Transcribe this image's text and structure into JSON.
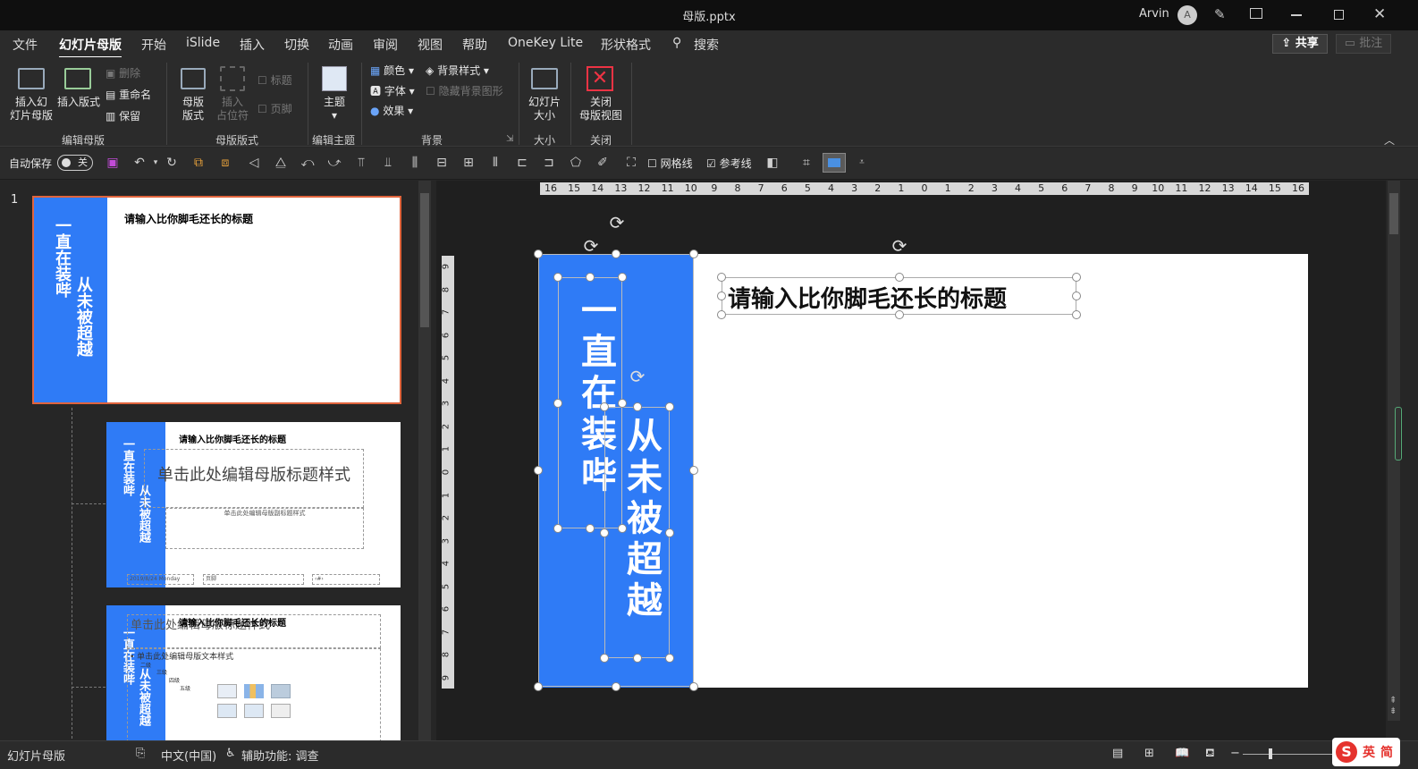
{
  "window": {
    "title": "母版.pptx",
    "user": "Arvin",
    "avatar_letter": "A"
  },
  "menu": {
    "tabs": [
      "文件",
      "幻灯片母版",
      "开始",
      "iSlide",
      "插入",
      "切换",
      "动画",
      "审阅",
      "视图",
      "帮助",
      "OneKey Lite",
      "形状格式"
    ],
    "search_label": "搜索",
    "share_label": "共享",
    "comment_label": "批注"
  },
  "ribbon": {
    "insert_master": "插入幻\n灯片母版",
    "insert_layout": "插入版式",
    "delete": "删除",
    "rename": "重命名",
    "preserve": "保留",
    "group_edit_master": "编辑母版",
    "master_layout": "母版\n版式",
    "insert_placeholder": "插入\n占位符",
    "title_cb": "标题",
    "footer_cb": "页脚",
    "group_master_layout": "母版版式",
    "theme": "主题",
    "group_edit_theme": "编辑主题",
    "colors": "颜色",
    "fonts": "字体",
    "effects": "效果",
    "bg_styles": "背景样式",
    "hide_bg": "隐藏背景图形",
    "group_background": "背景",
    "slide_size": "幻灯片\n大小",
    "group_size": "大小",
    "close_master": "关闭\n母版视图",
    "group_close": "关闭"
  },
  "qat": {
    "autosave": "自动保存",
    "autosave_state": "关",
    "gridlines": "网格线",
    "guides": "参考线"
  },
  "slides": {
    "index": "1",
    "title": "请输入比你脚毛还长的标题",
    "vtext1": "一直在装哔",
    "vtext2": "从未被超越",
    "layout1_title": "单击此处编辑母版标题样式",
    "layout1_sub": "单击此处编辑母版副标题样式",
    "layout1_date": "2019/8/24 Monday",
    "layout1_footer": "页脚",
    "layout1_num": "‹#›",
    "layout2_title": "单击此处编辑母版标题样式",
    "layout2_body": "单击此处编辑母版文本样式",
    "layout2_l2": "二级",
    "layout2_l3": "三级",
    "layout2_l4": "四级",
    "layout2_l5": "五级"
  },
  "ruler_h": [
    "16",
    "15",
    "14",
    "13",
    "12",
    "11",
    "10",
    "9",
    "8",
    "7",
    "6",
    "5",
    "4",
    "3",
    "2",
    "1",
    "0",
    "1",
    "2",
    "3",
    "4",
    "5",
    "6",
    "7",
    "8",
    "9",
    "10",
    "11",
    "12",
    "13",
    "14",
    "15",
    "16"
  ],
  "ruler_v": [
    "9",
    "8",
    "7",
    "6",
    "5",
    "4",
    "3",
    "2",
    "1",
    "0",
    "1",
    "2",
    "3",
    "4",
    "5",
    "6",
    "7",
    "8",
    "9"
  ],
  "status": {
    "view": "幻灯片母版",
    "lang": "中文(中国)",
    "accessibility": "辅助功能: 调查"
  },
  "ime": {
    "logo": "S",
    "mode": "英",
    "script": "简"
  },
  "colors": {
    "accent_blue": "#2f7bf6",
    "selected_border": "#e0643c"
  }
}
